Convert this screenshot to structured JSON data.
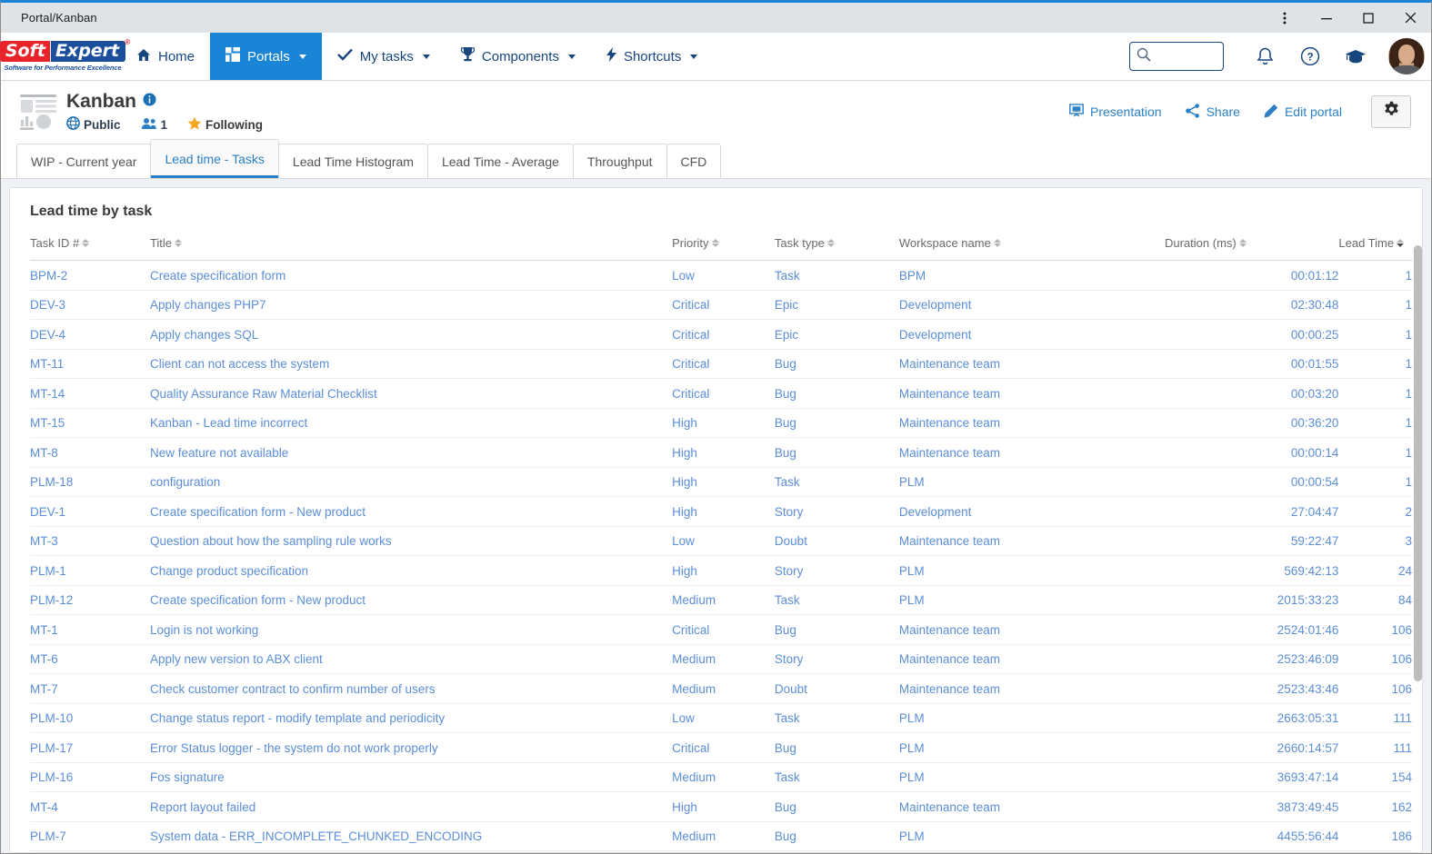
{
  "window": {
    "title": "Portal/Kanban",
    "controls": [
      "more-options",
      "minimize",
      "maximize",
      "close"
    ]
  },
  "brand": {
    "soft": "Soft",
    "expert": "Expert",
    "registered": "®",
    "tagline": "Software for Performance Excellence"
  },
  "nav": {
    "items": [
      {
        "label": "Home",
        "icon": "home-icon",
        "caret": false,
        "active": false
      },
      {
        "label": "Portals",
        "icon": "grid-icon",
        "caret": true,
        "active": true
      },
      {
        "label": "My tasks",
        "icon": "check-icon",
        "caret": true,
        "active": false
      },
      {
        "label": "Components",
        "icon": "trophy-icon",
        "caret": true,
        "active": false
      },
      {
        "label": "Shortcuts",
        "icon": "bolt-icon",
        "caret": true,
        "active": false
      }
    ],
    "search": {
      "value": "",
      "placeholder": ""
    },
    "icons": [
      "bell-icon",
      "help-circle-icon",
      "graduation-cap-icon",
      "avatar"
    ]
  },
  "portal": {
    "title": "Kanban",
    "info_icon": "info-icon",
    "visibility": "Public",
    "members_count": "1",
    "follow_label": "Following",
    "actions": [
      {
        "label": "Presentation",
        "icon": "presentation-icon"
      },
      {
        "label": "Share",
        "icon": "share-icon"
      },
      {
        "label": "Edit portal",
        "icon": "pencil-icon"
      }
    ],
    "settings_icon": "gear-icon"
  },
  "tabs": [
    {
      "label": "WIP - Current year",
      "active": false
    },
    {
      "label": "Lead time - Tasks",
      "active": true
    },
    {
      "label": "Lead Time Histogram",
      "active": false
    },
    {
      "label": "Lead Time - Average",
      "active": false
    },
    {
      "label": "Throughput",
      "active": false
    },
    {
      "label": "CFD",
      "active": false
    }
  ],
  "panel": {
    "title": "Lead time by task",
    "columns": [
      {
        "label": "Task ID #",
        "sorted": false,
        "align": "left"
      },
      {
        "label": "Title",
        "sorted": false,
        "align": "left"
      },
      {
        "label": "Priority",
        "sorted": false,
        "align": "left"
      },
      {
        "label": "Task type",
        "sorted": false,
        "align": "left"
      },
      {
        "label": "Workspace name",
        "sorted": false,
        "align": "left"
      },
      {
        "label": "Duration (ms)",
        "sorted": false,
        "align": "right"
      },
      {
        "label": "Lead Time",
        "sorted": true,
        "align": "right"
      }
    ],
    "rows": [
      {
        "id": "BPM-2",
        "title": "Create specification form",
        "priority": "Low",
        "type": "Task",
        "workspace": "BPM",
        "duration": "00:01:12",
        "lead_time": "1"
      },
      {
        "id": "DEV-3",
        "title": "Apply changes PHP7",
        "priority": "Critical",
        "type": "Epic",
        "workspace": "Development",
        "duration": "02:30:48",
        "lead_time": "1"
      },
      {
        "id": "DEV-4",
        "title": "Apply changes SQL",
        "priority": "Critical",
        "type": "Epic",
        "workspace": "Development",
        "duration": "00:00:25",
        "lead_time": "1"
      },
      {
        "id": "MT-11",
        "title": "Client can not access the system",
        "priority": "Critical",
        "type": "Bug",
        "workspace": "Maintenance team",
        "duration": "00:01:55",
        "lead_time": "1"
      },
      {
        "id": "MT-14",
        "title": "Quality Assurance Raw Material Checklist",
        "priority": "Critical",
        "type": "Bug",
        "workspace": "Maintenance team",
        "duration": "00:03:20",
        "lead_time": "1"
      },
      {
        "id": "MT-15",
        "title": "Kanban - Lead time incorrect",
        "priority": "High",
        "type": "Bug",
        "workspace": "Maintenance team",
        "duration": "00:36:20",
        "lead_time": "1"
      },
      {
        "id": "MT-8",
        "title": "New feature not available",
        "priority": "High",
        "type": "Bug",
        "workspace": "Maintenance team",
        "duration": "00:00:14",
        "lead_time": "1"
      },
      {
        "id": "PLM-18",
        "title": "configuration",
        "priority": "High",
        "type": "Task",
        "workspace": "PLM",
        "duration": "00:00:54",
        "lead_time": "1"
      },
      {
        "id": "DEV-1",
        "title": "Create specification form - New product",
        "priority": "High",
        "type": "Story",
        "workspace": "Development",
        "duration": "27:04:47",
        "lead_time": "2"
      },
      {
        "id": "MT-3",
        "title": "Question about how the sampling rule works",
        "priority": "Low",
        "type": "Doubt",
        "workspace": "Maintenance team",
        "duration": "59:22:47",
        "lead_time": "3"
      },
      {
        "id": "PLM-1",
        "title": "Change product specification",
        "priority": "High",
        "type": "Story",
        "workspace": "PLM",
        "duration": "569:42:13",
        "lead_time": "24"
      },
      {
        "id": "PLM-12",
        "title": "Create specification form - New product",
        "priority": "Medium",
        "type": "Task",
        "workspace": "PLM",
        "duration": "2015:33:23",
        "lead_time": "84"
      },
      {
        "id": "MT-1",
        "title": "Login is not working",
        "priority": "Critical",
        "type": "Bug",
        "workspace": "Maintenance team",
        "duration": "2524:01:46",
        "lead_time": "106"
      },
      {
        "id": "MT-6",
        "title": "Apply new version to ABX client",
        "priority": "Medium",
        "type": "Story",
        "workspace": "Maintenance team",
        "duration": "2523:46:09",
        "lead_time": "106"
      },
      {
        "id": "MT-7",
        "title": "Check customer contract to confirm number of users",
        "priority": "Medium",
        "type": "Doubt",
        "workspace": "Maintenance team",
        "duration": "2523:43:46",
        "lead_time": "106"
      },
      {
        "id": "PLM-10",
        "title": "Change status report - modify template and periodicity",
        "priority": "Low",
        "type": "Task",
        "workspace": "PLM",
        "duration": "2663:05:31",
        "lead_time": "111"
      },
      {
        "id": "PLM-17",
        "title": "Error Status logger - the system do not work properly",
        "priority": "Critical",
        "type": "Bug",
        "workspace": "PLM",
        "duration": "2660:14:57",
        "lead_time": "111"
      },
      {
        "id": "PLM-16",
        "title": "Fos signature",
        "priority": "Medium",
        "type": "Task",
        "workspace": "PLM",
        "duration": "3693:47:14",
        "lead_time": "154"
      },
      {
        "id": "MT-4",
        "title": "Report layout failed",
        "priority": "High",
        "type": "Bug",
        "workspace": "Maintenance team",
        "duration": "3873:49:45",
        "lead_time": "162"
      },
      {
        "id": "PLM-7",
        "title": "System data - ERR_INCOMPLETE_CHUNKED_ENCODING",
        "priority": "Medium",
        "type": "Bug",
        "workspace": "PLM",
        "duration": "4455:56:44",
        "lead_time": "186"
      }
    ]
  },
  "colors": {
    "accent": "#1a85d6",
    "link": "#5b8ed6",
    "action_link": "#2b7fc4",
    "brand_red": "#e8232a",
    "brand_blue": "#1b4f9c",
    "star": "#f5a623",
    "content_bg": "#eef1f6"
  }
}
